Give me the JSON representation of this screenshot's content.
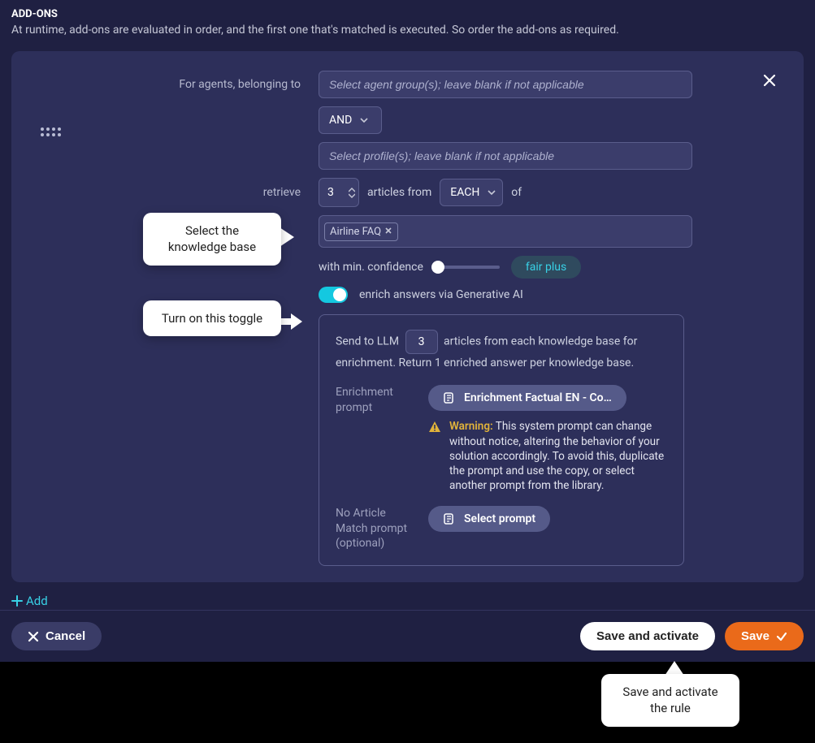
{
  "section": {
    "title": "ADD-ONS",
    "description": "At runtime, add-ons are evaluated in order, and the first one that's matched is executed. So order the add-ons as required."
  },
  "rule": {
    "agents_label": "For agents, belonging to",
    "agent_group_placeholder": "Select agent group(s); leave blank if not applicable",
    "operator": "AND",
    "profile_placeholder": "Select profile(s); leave blank if not applicable",
    "retrieve_label": "retrieve",
    "retrieve_count": "3",
    "articles_from_label": "articles from",
    "scope": "EACH",
    "of_label": "of",
    "kb_tag": "Airline FAQ",
    "confidence_label": "with min. confidence",
    "confidence_pill": "fair plus",
    "enrich_label": "enrich answers via Generative AI"
  },
  "enrich": {
    "llm_pre": "Send to LLM",
    "llm_count": "3",
    "llm_post": "articles from each knowledge base for enrichment. Return 1 enriched answer per knowledge base.",
    "prompt_label": "Enrichment prompt",
    "prompt_value": "Enrichment Factual EN - Co…",
    "warning_word": "Warning:",
    "warning_text": "This system prompt can change without notice, altering the behavior of your solution accordingly. To avoid this, duplicate the prompt and use the copy, or select another prompt from the library.",
    "no_match_label": "No Article Match prompt (optional)",
    "select_prompt": "Select prompt"
  },
  "actions": {
    "add": "Add",
    "cancel": "Cancel",
    "save_activate": "Save and activate",
    "save": "Save"
  },
  "callouts": {
    "select_kb": "Select the knowledge base",
    "turn_on_toggle": "Turn on this toggle",
    "save_activate_tip": "Save and activate the rule"
  }
}
